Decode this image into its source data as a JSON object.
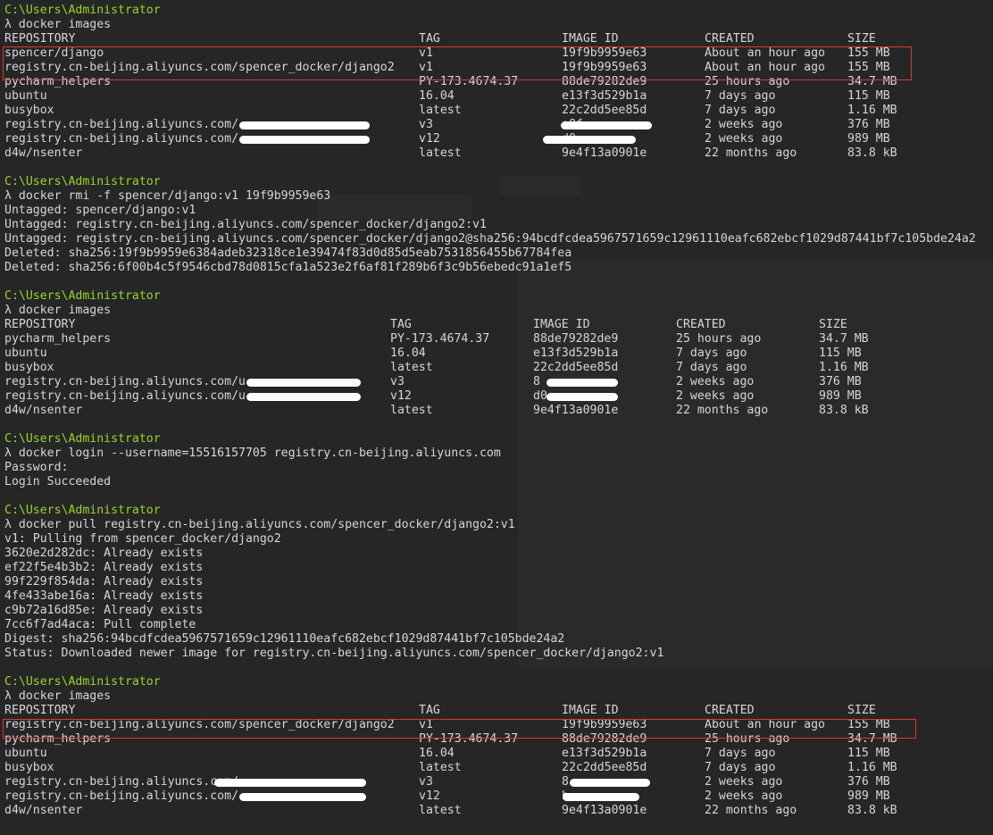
{
  "colors": {
    "background": "#262626",
    "text": "#d6d6d6",
    "prompt_path": "#9ad42a",
    "highlight_border": "#d83a3a",
    "redaction": "#ffffff"
  },
  "prompt": {
    "path": "C:\\Users\\Administrator",
    "symbol": "λ"
  },
  "block1": {
    "command": "λ docker images",
    "headers": [
      "REPOSITORY",
      "TAG",
      "IMAGE ID",
      "CREATED",
      "SIZE"
    ],
    "rows": [
      [
        "spencer/django",
        "v1",
        "19f9b9959e63",
        "About an hour ago",
        "155 MB"
      ],
      [
        "registry.cn-beijing.aliyuncs.com/spencer_docker/django2",
        "v1",
        "19f9b9959e63",
        "About an hour ago",
        "155 MB"
      ],
      [
        "pycharm_helpers",
        "PY-173.4674.37",
        "88de79282de9",
        "25 hours ago",
        "34.7 MB"
      ],
      [
        "ubuntu",
        "16.04",
        "e13f3d529b1a",
        "7 days ago",
        "115 MB"
      ],
      [
        "busybox",
        "latest",
        "22c2dd5ee85d",
        "7 days ago",
        "1.16 MB"
      ],
      [
        "registry.cn-beijing.aliyuncs.com/",
        "v3",
        "e8f",
        "2 weeks ago",
        "376 MB"
      ],
      [
        "registry.cn-beijing.aliyuncs.com/",
        "v12",
        "d0",
        "2 weeks ago",
        "989 MB"
      ],
      [
        "d4w/nsenter",
        "latest",
        "9e4f13a0901e",
        "22 months ago",
        "83.8 kB"
      ]
    ]
  },
  "block2": {
    "command": "λ docker rmi -f spencer/django:v1 19f9b9959e63",
    "output": [
      "Untagged: spencer/django:v1",
      "Untagged: registry.cn-beijing.aliyuncs.com/spencer_docker/django2:v1",
      "Untagged: registry.cn-beijing.aliyuncs.com/spencer_docker/django2@sha256:94bcdfcdea5967571659c12961110eafc682ebcf1029d87441bf7c105bde24a2",
      "Deleted: sha256:19f9b9959e6384adeb32318ce1e39474f83d0d85d5eab7531856455b67784fea",
      "Deleted: sha256:6f00b4c5f9546cbd78d0815cfa1a523e2f6af81f289b6f3c9b56ebedc91a1ef5"
    ]
  },
  "block3": {
    "command": "λ docker images",
    "headers": [
      "REPOSITORY",
      "TAG",
      "IMAGE ID",
      "CREATED",
      "SIZE"
    ],
    "rows": [
      [
        "pycharm_helpers",
        "PY-173.4674.37",
        "88de79282de9",
        "25 hours ago",
        "34.7 MB"
      ],
      [
        "ubuntu",
        "16.04",
        "e13f3d529b1a",
        "7 days ago",
        "115 MB"
      ],
      [
        "busybox",
        "latest",
        "22c2dd5ee85d",
        "7 days ago",
        "1.16 MB"
      ],
      [
        "registry.cn-beijing.aliyuncs.com/u",
        "v3",
        "8",
        "2 weeks ago",
        "376 MB"
      ],
      [
        "registry.cn-beijing.aliyuncs.com/u",
        "v12",
        "d0",
        "2 weeks ago",
        "989 MB"
      ],
      [
        "d4w/nsenter",
        "latest",
        "9e4f13a0901e",
        "22 months ago",
        "83.8 kB"
      ]
    ]
  },
  "block4": {
    "command": "λ docker login --username=15516157705 registry.cn-beijing.aliyuncs.com",
    "output": [
      "Password:",
      "Login Succeeded"
    ]
  },
  "block5": {
    "command": "λ docker pull registry.cn-beijing.aliyuncs.com/spencer_docker/django2:v1",
    "output": [
      "v1: Pulling from spencer_docker/django2",
      "3620e2d282dc: Already exists",
      "ef22f5e4b3b2: Already exists",
      "99f229f854da: Already exists",
      "4fe433abe16a: Already exists",
      "c9b72a16d85e: Already exists",
      "7cc6f7ad4aca: Pull complete",
      "Digest: sha256:94bcdfcdea5967571659c12961110eafc682ebcf1029d87441bf7c105bde24a2",
      "Status: Downloaded newer image for registry.cn-beijing.aliyuncs.com/spencer_docker/django2:v1"
    ]
  },
  "block6": {
    "command": "λ docker images",
    "headers": [
      "REPOSITORY",
      "TAG",
      "IMAGE ID",
      "CREATED",
      "SIZE"
    ],
    "rows": [
      [
        "registry.cn-beijing.aliyuncs.com/spencer_docker/django2",
        "v1",
        "19f9b9959e63",
        "About an hour ago",
        "155 MB"
      ],
      [
        "pycharm_helpers",
        "PY-173.4674.37",
        "88de79282de9",
        "25 hours ago",
        "34.7 MB"
      ],
      [
        "ubuntu",
        "16.04",
        "e13f3d529b1a",
        "7 days ago",
        "115 MB"
      ],
      [
        "busybox",
        "latest",
        "22c2dd5ee85d",
        "7 days ago",
        "1.16 MB"
      ],
      [
        "registry.cn-beijing.aliyuncs.com/",
        "v3",
        "8",
        "2 weeks ago",
        "376 MB"
      ],
      [
        "registry.cn-beijing.aliyuncs.com/",
        "v12",
        "b",
        "2 weeks ago",
        "989 MB"
      ],
      [
        "d4w/nsenter",
        "latest",
        "9e4f13a0901e",
        "22 months ago",
        "83.8 kB"
      ]
    ]
  }
}
